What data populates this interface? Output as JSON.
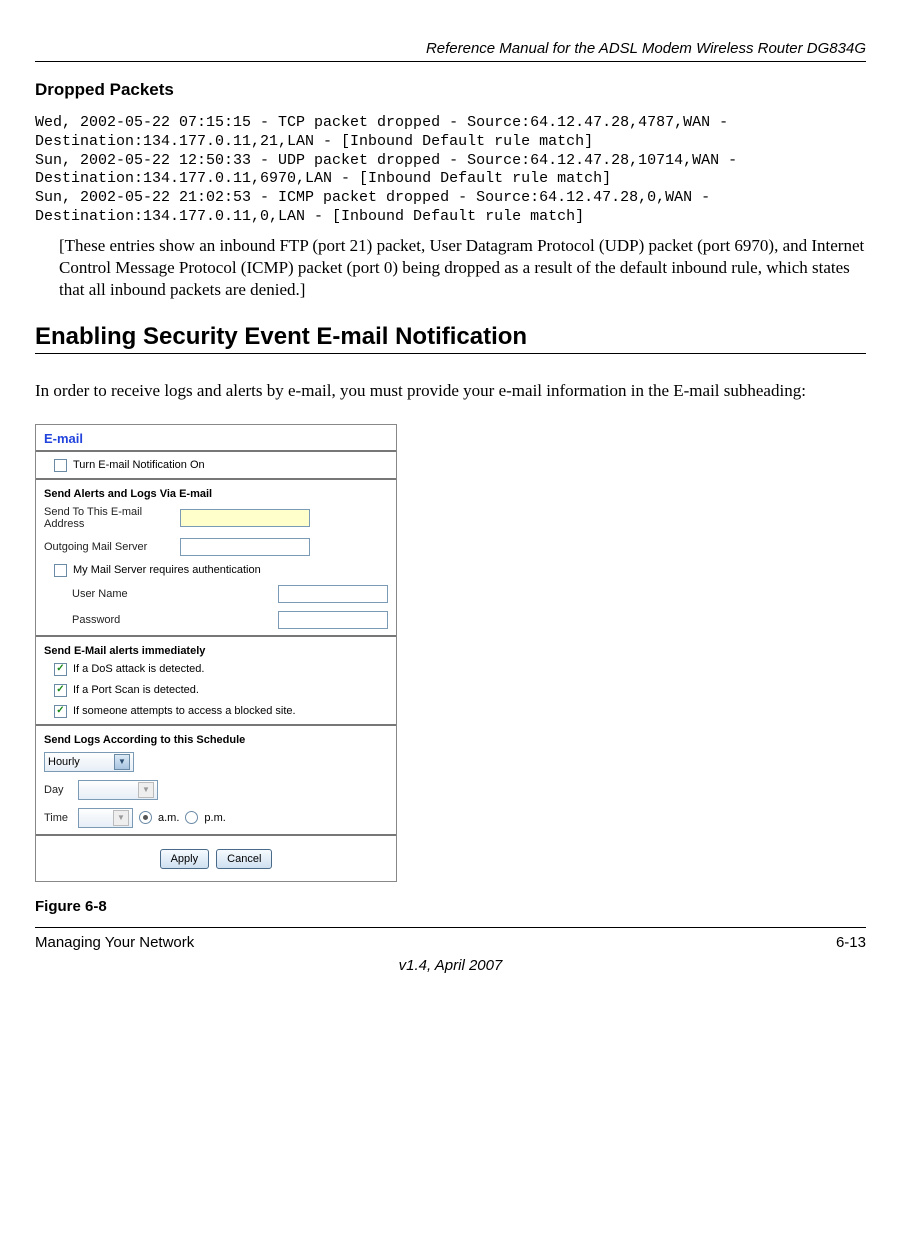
{
  "header": {
    "doc_title": "Reference Manual for the ADSL Modem Wireless Router DG834G"
  },
  "sections": {
    "dropped_heading": "Dropped Packets",
    "log_text": "Wed, 2002-05-22 07:15:15 - TCP packet dropped - Source:64.12.47.28,4787,WAN - Destination:134.177.0.11,21,LAN - [Inbound Default rule match]\nSun, 2002-05-22 12:50:33 - UDP packet dropped - Source:64.12.47.28,10714,WAN - Destination:134.177.0.11,6970,LAN - [Inbound Default rule match]\nSun, 2002-05-22 21:02:53 - ICMP packet dropped - Source:64.12.47.28,0,WAN - Destination:134.177.0.11,0,LAN - [Inbound Default rule match]",
    "explanation": "[These entries show an inbound FTP (port 21) packet, User Datagram Protocol (UDP) packet (port 6970), and Internet Control Message Protocol (ICMP) packet (port 0) being dropped as a result of the default inbound rule, which states that all inbound packets are denied.]",
    "main_heading": "Enabling Security Event E-mail Notification",
    "intro": "In order to receive logs and alerts by e-mail, you must provide your e-mail information in the E-mail subheading:"
  },
  "email_panel": {
    "title": "E-mail",
    "turn_on_label": "Turn E-mail Notification On",
    "section_send": "Send Alerts and Logs Via E-mail",
    "addr_label": "Send To This E-mail Address",
    "server_label": "Outgoing Mail Server",
    "auth_label": "My Mail Server requires authentication",
    "user_label": "User Name",
    "pass_label": "Password",
    "section_alerts": "Send E-Mail alerts immediately",
    "alert_dos": "If a DoS attack is detected.",
    "alert_portscan": "If a Port Scan is detected.",
    "alert_blocked": "If someone attempts to access a blocked site.",
    "section_schedule": "Send Logs According to this Schedule",
    "schedule_value": "Hourly",
    "day_label": "Day",
    "time_label": "Time",
    "am_label": "a.m.",
    "pm_label": "p.m.",
    "btn_apply": "Apply",
    "btn_cancel": "Cancel"
  },
  "figure_caption": "Figure 6-8",
  "footer": {
    "left": "Managing Your Network",
    "right": "6-13",
    "center": "v1.4, April 2007"
  }
}
